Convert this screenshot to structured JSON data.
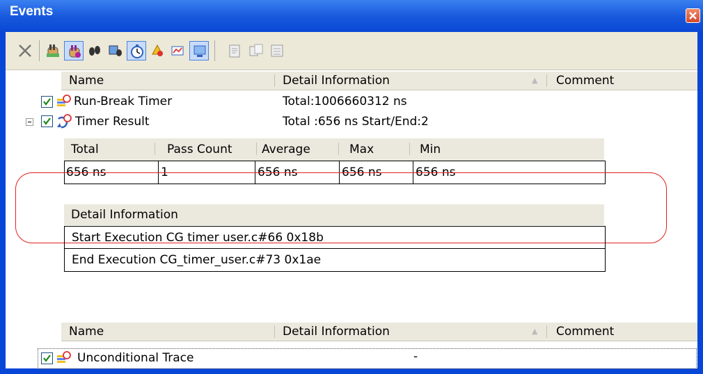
{
  "window": {
    "title": "Events"
  },
  "toolbar": {
    "buttons": [
      {
        "icon": "delete-x-icon"
      },
      {
        "icon": "hardware-break-icon"
      },
      {
        "icon": "software-break-icon"
      },
      {
        "icon": "trace-icon"
      },
      {
        "icon": "trace-display-icon"
      },
      {
        "icon": "timer-icon"
      },
      {
        "icon": "event-condition-icon"
      },
      {
        "icon": "performance-icon"
      },
      {
        "icon": "edit-comment-icon"
      },
      {
        "icon": "copy-event-icon"
      },
      {
        "icon": "event-list-icon"
      }
    ]
  },
  "table": {
    "headers": {
      "name": "Name",
      "detail": "Detail Information",
      "comment": "Comment"
    },
    "rows": [
      {
        "name": "Run-Break Timer",
        "detail": "Total:1006660312 ns",
        "checked": true
      },
      {
        "name": "Timer Result",
        "detail": "Total :656 ns   Start/End:2",
        "checked": true,
        "expanded": true
      }
    ]
  },
  "timer_result": {
    "headers": [
      "Total",
      "Pass Count",
      "Average",
      "Max",
      "Min"
    ],
    "values": [
      "656 ns",
      "1",
      "656 ns",
      "656 ns",
      "656 ns"
    ]
  },
  "detail_info": {
    "header": "Detail Information",
    "start": "Start Execution  CG timer user.c#66 0x18b",
    "end": "End Execution  CG_timer_user.c#73 0x1ae"
  },
  "table2": {
    "headers": {
      "name": "Name",
      "detail": "Detail Information",
      "comment": "Comment"
    },
    "rows": [
      {
        "name": "Unconditional Trace",
        "detail": "-",
        "checked": true
      }
    ]
  },
  "colors": {
    "title_bar": "#1657dc",
    "highlight_oval": "#e02020",
    "check_mark": "#1c8a1c"
  }
}
